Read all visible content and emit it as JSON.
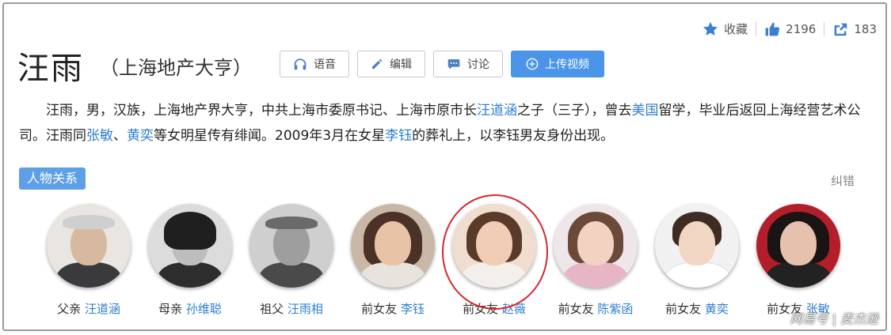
{
  "header": {
    "title": "汪雨",
    "subtitle": "（上海地产大亨）",
    "actions": {
      "favorite_label": "收藏",
      "like_count": "2196",
      "share_count": "183"
    },
    "buttons": {
      "voice": "语音",
      "edit": "编辑",
      "discuss": "讨论",
      "upload_video": "上传视频"
    }
  },
  "summary": {
    "seg1": "汪雨，男，汉族，上海地产界大亨，中共上海市委原书记、上海市原市长",
    "link1": "汪道涵",
    "seg2": "之子（三子），曾去",
    "link2": "美国",
    "seg3": "留学，毕业后返回上海经营艺术公司。汪雨同",
    "link3": "张敏",
    "seg4": "、",
    "link4": "黄奕",
    "seg5": "等女明星传有绯闻。2009年3月在女星",
    "link5": "李钰",
    "seg6": "的葬礼上，以李钰男友身份出现。"
  },
  "relations": {
    "tag": "人物关系",
    "report": "纠错",
    "people": [
      {
        "role": "父亲",
        "name": "汪道涵"
      },
      {
        "role": "母亲",
        "name": "孙维聪"
      },
      {
        "role": "祖父",
        "name": "汪雨相"
      },
      {
        "role": "前女友",
        "name": "李钰"
      },
      {
        "role": "前女友",
        "name": "赵薇"
      },
      {
        "role": "前女友",
        "name": "陈紫函"
      },
      {
        "role": "前女友",
        "name": "黄奕"
      },
      {
        "role": "前女友",
        "name": "张敏"
      }
    ]
  },
  "watermark": "网易号 | 麦杰逊",
  "colors": {
    "link": "#2e7fd0",
    "accent": "#4a95ea",
    "highlight": "#d8252d"
  },
  "icons": [
    "star-icon",
    "thumbs-up-icon",
    "share-icon",
    "headphones-icon",
    "pencil-icon",
    "chat-icon",
    "plus-circle-icon"
  ]
}
